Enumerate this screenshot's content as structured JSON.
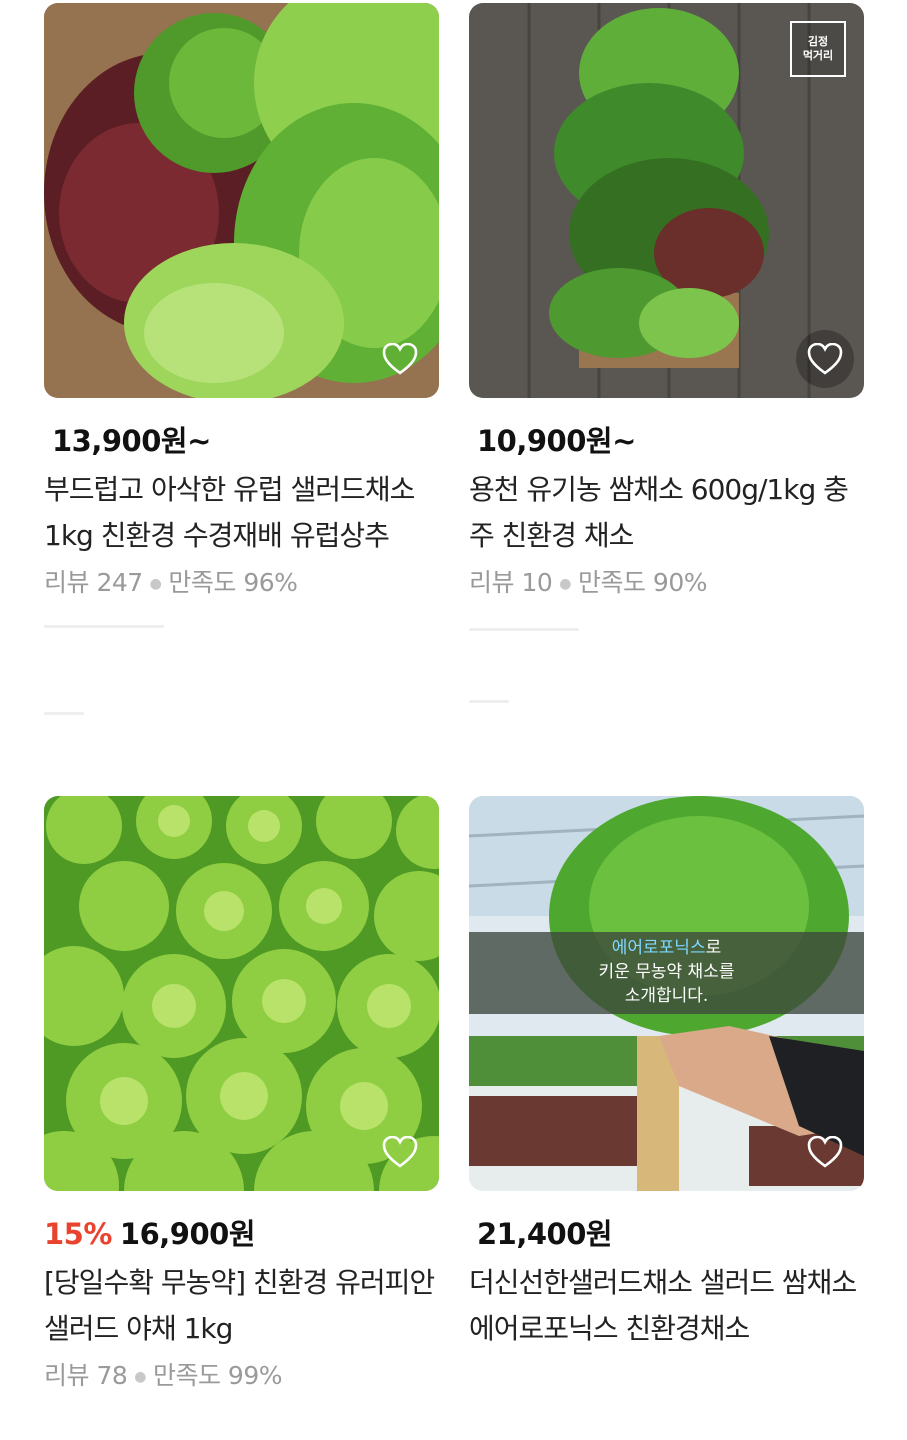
{
  "products": [
    {
      "price": "13,900원~",
      "discount": "",
      "title": "부드럽고 아삭한 유럽 샐러드채소 1kg 친환경 수경재배 유럽상추",
      "reviews": "리뷰 247",
      "satisfaction": "만족도 96%",
      "image_icon": "mixed-lettuce-image"
    },
    {
      "price": "10,900원~",
      "discount": "",
      "title": "용천 유기농 쌈채소 600g/1kg 충주 친환경 채소",
      "reviews": "리뷰 10",
      "satisfaction": "만족도 90%",
      "image_icon": "vegetable-box-image",
      "badge_line1": "김정",
      "badge_line2": "먹거리"
    },
    {
      "price": "16,900원",
      "discount": "15%",
      "title": "[당일수확 무농약] 친환경 유러피안샐러드 야채 1kg",
      "reviews": "리뷰 78",
      "satisfaction": "만족도 99%",
      "image_icon": "butterhead-field-image"
    },
    {
      "price": "21,400원",
      "discount": "",
      "title": "더신선한샐러드채소 샐러드 쌈채소 에어로포닉스 친환경채소",
      "image_icon": "aeroponics-lettuce-image",
      "overlay_line1_highlight": "에어로포닉스",
      "overlay_line1_rest": "로",
      "overlay_line2": "키운 무농약 채소를",
      "overlay_line3": "소개합니다."
    }
  ],
  "colors": {
    "discount": "#e8432f",
    "meta": "#9a9a9a",
    "price": "#111111"
  }
}
